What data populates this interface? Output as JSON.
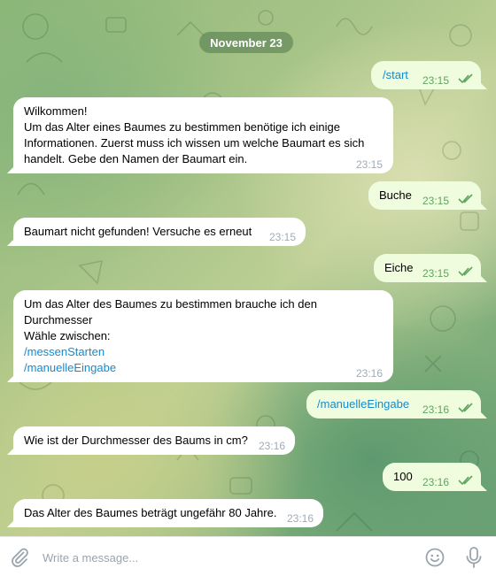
{
  "chat": {
    "date": "November 23",
    "messages": [
      {
        "dir": "out",
        "text": "/start",
        "time": "23:15"
      },
      {
        "dir": "in",
        "text": "Wilkommen!\nUm das Alter eines Baumes zu bestimmen benötige ich einige\nInformationen. Zuerst muss ich wissen um welche Baumart es sich\nhandelt. Gebe den Namen der Baumart ein.",
        "time": "23:15"
      },
      {
        "dir": "out",
        "text": "Buche",
        "time": "23:15"
      },
      {
        "dir": "in",
        "text": "Baumart nicht gefunden! Versuche es erneut",
        "time": "23:15"
      },
      {
        "dir": "out",
        "text": "Eiche",
        "time": "23:15"
      },
      {
        "dir": "in",
        "text_lines": [
          "Um das Alter des Baumes zu bestimmen brauche ich den",
          "Durchmesser",
          "Wähle zwischen:"
        ],
        "links": [
          "/messenStarten",
          "/manuelleEingabe"
        ],
        "time": "23:16"
      },
      {
        "dir": "out",
        "text": "/manuelleEingabe",
        "time": "23:16"
      },
      {
        "dir": "in",
        "text": "Wie ist der Durchmesser des Baums in cm?",
        "time": "23:16"
      },
      {
        "dir": "out",
        "text": "100",
        "time": "23:16"
      },
      {
        "dir": "in",
        "text": "Das Alter des Baumes beträgt ungefähr 80 Jahre.",
        "time": "23:16"
      }
    ]
  },
  "composer": {
    "placeholder": "Write a message...",
    "icons": [
      "paperclip-icon",
      "smile-icon",
      "microphone-icon"
    ]
  },
  "colors": {
    "incoming_bubble": "#ffffff",
    "outgoing_bubble": "#effdde",
    "link": "#168acd",
    "read_check": "#5ea55e"
  }
}
